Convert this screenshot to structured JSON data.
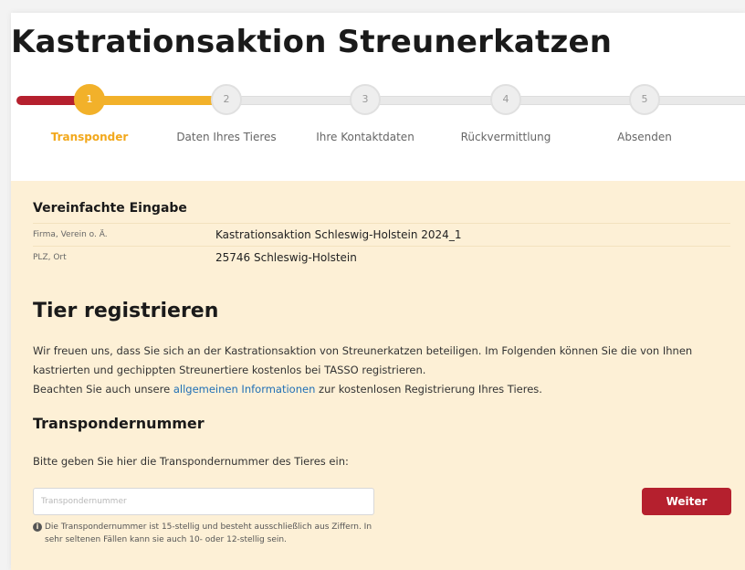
{
  "header": {
    "title": "Kastrationsaktion Streunerkatzen"
  },
  "stepper": {
    "steps": [
      {
        "number": "1",
        "label": "Transponder"
      },
      {
        "number": "2",
        "label": "Daten Ihres Tieres"
      },
      {
        "number": "3",
        "label": "Ihre Kontaktdaten"
      },
      {
        "number": "4",
        "label": "Rückvermittlung"
      },
      {
        "number": "5",
        "label": "Absenden"
      }
    ]
  },
  "simplified": {
    "title": "Vereinfachte Eingabe",
    "rows": [
      {
        "key": "Firma, Verein o. Ä.",
        "value": "Kastrationsaktion Schleswig-Holstein 2024_1"
      },
      {
        "key": "PLZ, Ort",
        "value": "25746 Schleswig-Holstein"
      }
    ]
  },
  "register": {
    "title": "Tier registrieren",
    "intro_line1": "Wir freuen uns, dass Sie sich an der Kastrationsaktion von Streunerkatzen beteiligen. Im Folgenden können Sie die von Ihnen kastrierten und gechippten Streunertiere kostenlos bei TASSO registrieren.",
    "intro_line2_before": "Beachten Sie auch unsere ",
    "intro_link": "allgemeinen Informationen",
    "intro_line2_after": " zur kostenlosen Registrierung Ihres Tieres."
  },
  "transponder": {
    "title": "Transpondernummer",
    "prompt": "Bitte geben Sie hier die Transpondernummer des Tieres ein:",
    "placeholder": "Transpondernummer",
    "value": "",
    "button": "Weiter",
    "hint": "Die Transpondernummer ist 15-stellig und besteht ausschließlich aus Ziffern. In sehr seltenen Fällen kann sie auch 10- oder 12-stellig sein.",
    "hint_icon": "info-icon"
  },
  "colors": {
    "brand_red": "#b5202e",
    "accent_yellow": "#f2b12a",
    "form_bg": "#fdf0d6",
    "link_blue": "#1f6fb5"
  },
  "progress": {
    "current_step": 1,
    "total_steps": 5
  }
}
